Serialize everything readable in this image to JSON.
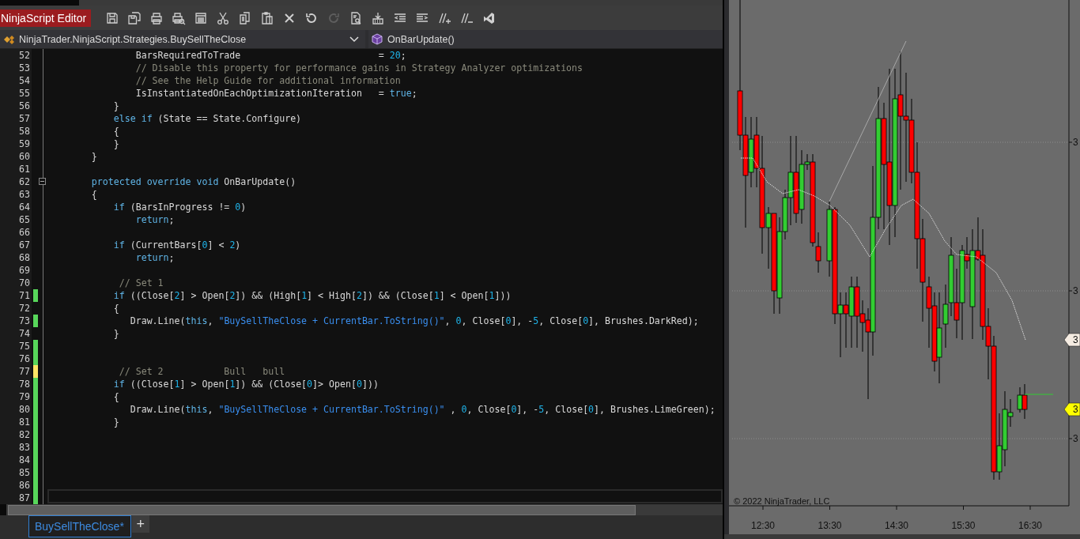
{
  "window": {
    "title": "NinjaScript Editor"
  },
  "toolbar": {
    "buttons": [
      {
        "disabled": false
      },
      {
        "disabled": false
      },
      {
        "disabled": false
      },
      {
        "disabled": false
      },
      {
        "disabled": false
      },
      {
        "disabled": false
      },
      {
        "disabled": false
      },
      {
        "disabled": false
      },
      {
        "disabled": false
      },
      {
        "disabled": false
      },
      {
        "disabled": true
      },
      {
        "disabled": false
      },
      {
        "disabled": false
      },
      {
        "disabled": false
      },
      {
        "disabled": false
      },
      {
        "disabled": false
      },
      {
        "disabled": false
      },
      {
        "disabled": false
      }
    ]
  },
  "type_dropdown": {
    "value": "NinjaTrader.NinjaScript.Strategies.BuySellTheClose"
  },
  "member_dropdown": {
    "value": "OnBarUpdate()"
  },
  "code_lines": [
    {
      "number": "52",
      "changed": false,
      "tokens": [
        {
          "kind": "plain",
          "text": "                BarsRequiredToTrade                         = "
        },
        {
          "kind": "number",
          "text": "20"
        },
        {
          "kind": "plain",
          "text": ";"
        }
      ]
    },
    {
      "number": "53",
      "changed": false,
      "tokens": [
        {
          "kind": "comment",
          "text": "                // Disable this property for performance gains in Strategy Analyzer optimizations"
        }
      ]
    },
    {
      "number": "54",
      "changed": false,
      "tokens": [
        {
          "kind": "comment",
          "text": "                // See the Help Guide for additional information"
        }
      ]
    },
    {
      "number": "55",
      "changed": false,
      "tokens": [
        {
          "kind": "plain",
          "text": "                IsInstantiatedOnEachOptimizationIteration   = "
        },
        {
          "kind": "keyword",
          "text": "true"
        },
        {
          "kind": "plain",
          "text": ";"
        }
      ]
    },
    {
      "number": "56",
      "changed": false,
      "tokens": [
        {
          "kind": "plain",
          "text": "            }"
        }
      ]
    },
    {
      "number": "57",
      "changed": false,
      "tokens": [
        {
          "kind": "keyword",
          "text": "            else if"
        },
        {
          "kind": "plain",
          "text": " (State == State.Configure)"
        }
      ]
    },
    {
      "number": "58",
      "changed": false,
      "tokens": [
        {
          "kind": "plain",
          "text": "            {"
        }
      ]
    },
    {
      "number": "59",
      "changed": false,
      "tokens": [
        {
          "kind": "plain",
          "text": "            }"
        }
      ]
    },
    {
      "number": "60",
      "changed": false,
      "tokens": [
        {
          "kind": "plain",
          "text": "        }"
        }
      ]
    },
    {
      "number": "61",
      "changed": false
    },
    {
      "number": "62",
      "changed": false,
      "expanded": true,
      "tokens": [
        {
          "kind": "keyword",
          "text": "        protected override void"
        },
        {
          "kind": "plain",
          "text": " OnBarUpdate()"
        }
      ]
    },
    {
      "number": "63",
      "changed": false,
      "tokens": [
        {
          "kind": "plain",
          "text": "        {"
        }
      ]
    },
    {
      "number": "64",
      "changed": false,
      "tokens": [
        {
          "kind": "keyword",
          "text": "            if"
        },
        {
          "kind": "plain",
          "text": " (BarsInProgress != "
        },
        {
          "kind": "number",
          "text": "0"
        },
        {
          "kind": "plain",
          "text": ")"
        }
      ]
    },
    {
      "number": "65",
      "changed": false,
      "tokens": [
        {
          "kind": "keyword",
          "text": "                return"
        },
        {
          "kind": "plain",
          "text": ";"
        }
      ]
    },
    {
      "number": "66",
      "changed": false
    },
    {
      "number": "67",
      "changed": false,
      "tokens": [
        {
          "kind": "keyword",
          "text": "            if"
        },
        {
          "kind": "plain",
          "text": " (CurrentBars["
        },
        {
          "kind": "number",
          "text": "0"
        },
        {
          "kind": "plain",
          "text": "] < "
        },
        {
          "kind": "number",
          "text": "2"
        },
        {
          "kind": "plain",
          "text": ")"
        }
      ]
    },
    {
      "number": "68",
      "changed": false,
      "tokens": [
        {
          "kind": "keyword",
          "text": "                return"
        },
        {
          "kind": "plain",
          "text": ";"
        }
      ]
    },
    {
      "number": "69",
      "changed": false
    },
    {
      "number": "70",
      "changed": false,
      "tokens": [
        {
          "kind": "comment",
          "text": "             // Set 1"
        }
      ]
    },
    {
      "number": "71",
      "changed": true,
      "saved": true,
      "tokens": [
        {
          "kind": "keyword",
          "text": "            if"
        },
        {
          "kind": "plain",
          "text": " ((Close["
        },
        {
          "kind": "number",
          "text": "2"
        },
        {
          "kind": "plain",
          "text": "] > Open["
        },
        {
          "kind": "number",
          "text": "2"
        },
        {
          "kind": "plain",
          "text": "]) && (High["
        },
        {
          "kind": "number",
          "text": "1"
        },
        {
          "kind": "plain",
          "text": "] < High["
        },
        {
          "kind": "number",
          "text": "2"
        },
        {
          "kind": "plain",
          "text": "]) && (Close["
        },
        {
          "kind": "number",
          "text": "1"
        },
        {
          "kind": "plain",
          "text": "] < Open["
        },
        {
          "kind": "number",
          "text": "1"
        },
        {
          "kind": "plain",
          "text": "]))"
        }
      ]
    },
    {
      "number": "72",
      "changed": false,
      "tokens": [
        {
          "kind": "plain",
          "text": "            {"
        }
      ]
    },
    {
      "number": "73",
      "changed": true,
      "saved": true,
      "tokens": [
        {
          "kind": "plain",
          "text": "               Draw.Line("
        },
        {
          "kind": "keyword",
          "text": "this"
        },
        {
          "kind": "plain",
          "text": ", "
        },
        {
          "kind": "string",
          "text": "\"BuySellTheClose + CurrentBar.ToString()\""
        },
        {
          "kind": "plain",
          "text": ", "
        },
        {
          "kind": "number",
          "text": "0"
        },
        {
          "kind": "plain",
          "text": ", Close["
        },
        {
          "kind": "number",
          "text": "0"
        },
        {
          "kind": "plain",
          "text": "], -"
        },
        {
          "kind": "number",
          "text": "5"
        },
        {
          "kind": "plain",
          "text": ", Close["
        },
        {
          "kind": "number",
          "text": "0"
        },
        {
          "kind": "plain",
          "text": "], Brushes.DarkRed);"
        }
      ]
    },
    {
      "number": "74",
      "changed": false,
      "tokens": [
        {
          "kind": "plain",
          "text": "            }"
        }
      ]
    },
    {
      "number": "75",
      "changed": true,
      "saved": true
    },
    {
      "number": "76",
      "changed": true,
      "saved": true
    },
    {
      "number": "77",
      "changed": true,
      "saved": false,
      "tokens": [
        {
          "kind": "comment",
          "text": "             // Set 2           Bull   bull"
        }
      ]
    },
    {
      "number": "78",
      "changed": true,
      "saved": true,
      "tokens": [
        {
          "kind": "keyword",
          "text": "            if"
        },
        {
          "kind": "plain",
          "text": " ((Close["
        },
        {
          "kind": "number",
          "text": "1"
        },
        {
          "kind": "plain",
          "text": "] > Open["
        },
        {
          "kind": "number",
          "text": "1"
        },
        {
          "kind": "plain",
          "text": "]) && (Close["
        },
        {
          "kind": "number",
          "text": "0"
        },
        {
          "kind": "plain",
          "text": "]> Open["
        },
        {
          "kind": "number",
          "text": "0"
        },
        {
          "kind": "plain",
          "text": "]))"
        }
      ]
    },
    {
      "number": "79",
      "changed": true,
      "saved": true,
      "tokens": [
        {
          "kind": "plain",
          "text": "            {"
        }
      ]
    },
    {
      "number": "80",
      "changed": true,
      "saved": true,
      "tokens": [
        {
          "kind": "plain",
          "text": "               Draw.Line("
        },
        {
          "kind": "keyword",
          "text": "this"
        },
        {
          "kind": "plain",
          "text": ", "
        },
        {
          "kind": "string",
          "text": "\"BuySellTheClose + CurrentBar.ToString()\""
        },
        {
          "kind": "plain",
          "text": " , "
        },
        {
          "kind": "number",
          "text": "0"
        },
        {
          "kind": "plain",
          "text": ", Close["
        },
        {
          "kind": "number",
          "text": "0"
        },
        {
          "kind": "plain",
          "text": "], -"
        },
        {
          "kind": "number",
          "text": "5"
        },
        {
          "kind": "plain",
          "text": ", Close["
        },
        {
          "kind": "number",
          "text": "0"
        },
        {
          "kind": "plain",
          "text": "], Brushes.LimeGreen);"
        }
      ]
    },
    {
      "number": "81",
      "changed": true,
      "saved": true,
      "tokens": [
        {
          "kind": "plain",
          "text": "            }"
        }
      ]
    },
    {
      "number": "82",
      "changed": true,
      "saved": true
    },
    {
      "number": "83",
      "changed": true,
      "saved": true
    },
    {
      "number": "84",
      "changed": true,
      "saved": true
    },
    {
      "number": "85",
      "changed": true,
      "saved": true
    },
    {
      "number": "86",
      "changed": true,
      "saved": true
    },
    {
      "number": "87",
      "changed": true,
      "saved": true
    }
  ],
  "file_tabs": [
    {
      "label": "BuySellTheClose*",
      "selected": true
    }
  ],
  "new_tab_button": {
    "label": "+"
  },
  "chart": {
    "price_labels": [
      "3",
      "3",
      "3"
    ],
    "price_tags": [
      {
        "label": "3",
        "color": "#f5ece2"
      },
      {
        "label": "3",
        "color": "#ffff00"
      }
    ],
    "time_labels": [
      "12:30",
      "13:30",
      "14:30",
      "15:30",
      "16:30"
    ],
    "copyright": "© 2022 NinjaTrader, LLC"
  }
}
